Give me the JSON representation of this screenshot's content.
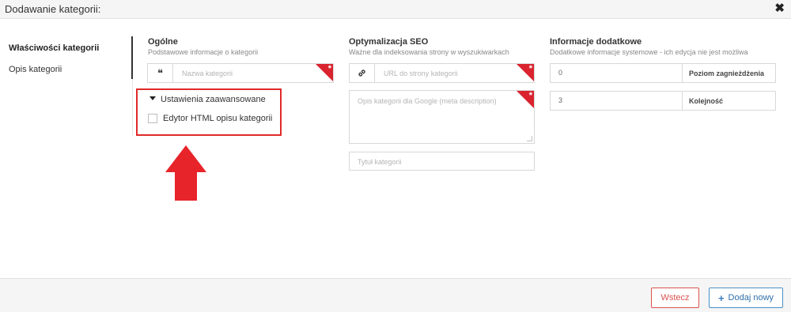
{
  "dialog": {
    "title": "Dodawanie kategorii:",
    "close_glyph": "✖"
  },
  "nav": {
    "items": [
      {
        "label": "Właściwości kategorii",
        "active": true
      },
      {
        "label": "Opis kategorii",
        "active": false
      }
    ]
  },
  "general": {
    "title": "Ogólne",
    "subtitle": "Podstawowe informacje o kategorii",
    "name_field": {
      "icon": "quote-icon",
      "glyph": "❝",
      "placeholder": "Nazwa kategorii",
      "value": "",
      "required": true
    }
  },
  "advanced": {
    "toggle_label": "Ustawienia zaawansowane",
    "html_editor_label": "Edytor HTML opisu kategorii",
    "html_editor_checked": false
  },
  "seo": {
    "title": "Optymalizacja SEO",
    "subtitle": "Ważne dla indeksowania strony w wyszukiwarkach",
    "url_field": {
      "icon": "link-icon",
      "placeholder": "URL do strony kategorii",
      "value": "",
      "required": true
    },
    "meta_description": {
      "placeholder": "Opis kategorii dla Google (meta description)",
      "value": "",
      "required": true
    },
    "page_title": {
      "placeholder": "Tytuł kategorii",
      "value": ""
    }
  },
  "info": {
    "title": "Informacje dodatkowe",
    "subtitle": "Dodatkowe informacje systemowe - ich edycja nie jest możliwa",
    "rows": [
      {
        "value": "0",
        "label": "Poziom zagnieżdżenia"
      },
      {
        "value": "3",
        "label": "Kolejność"
      }
    ]
  },
  "footer": {
    "back_label": "Wstecz",
    "add_label": "Dodaj nowy",
    "add_icon": "+"
  },
  "colors": {
    "required_marker": "#d9232e",
    "annotation_red": "#e8242b",
    "back_button": "#d9534f",
    "add_button": "#2e6fa8"
  }
}
